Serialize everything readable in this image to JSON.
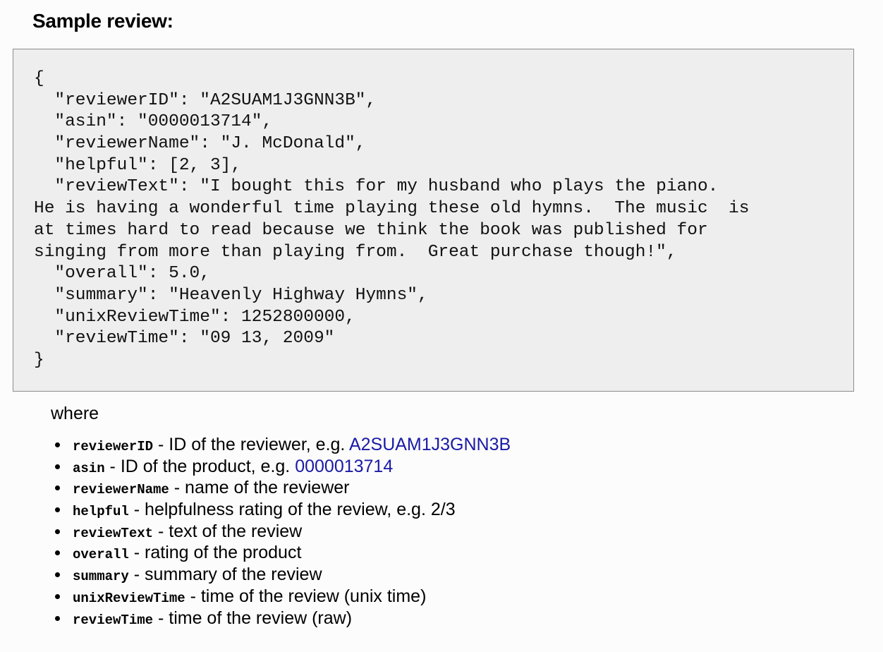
{
  "heading": "Sample review:",
  "code_lines": [
    "{",
    "  \"reviewerID\": \"A2SUAM1J3GNN3B\",",
    "  \"asin\": \"0000013714\",",
    "  \"reviewerName\": \"J. McDonald\",",
    "  \"helpful\": [2, 3],",
    "  \"reviewText\": \"I bought this for my husband who plays the piano.",
    "He is having a wonderful time playing these old hymns.  The music  is",
    "at times hard to read because we think the book was published for",
    "singing from more than playing from.  Great purchase though!\",",
    "  \"overall\": 5.0,",
    "  \"summary\": \"Heavenly Highway Hymns\",",
    "  \"unixReviewTime\": 1252800000,",
    "  \"reviewTime\": \"09 13, 2009\"",
    "}"
  ],
  "where_label": "where",
  "fields": [
    {
      "name": "reviewerID",
      "desc": " - ID of the reviewer, e.g. ",
      "link": "A2SUAM1J3GNN3B"
    },
    {
      "name": "asin",
      "desc": " - ID of the product, e.g. ",
      "link": "0000013714"
    },
    {
      "name": "reviewerName",
      "desc": " - name of the reviewer"
    },
    {
      "name": "helpful",
      "desc": " - helpfulness rating of the review, e.g. 2/3"
    },
    {
      "name": "reviewText",
      "desc": " - text of the review"
    },
    {
      "name": "overall",
      "desc": " - rating of the product"
    },
    {
      "name": "summary",
      "desc": " - summary of the review"
    },
    {
      "name": "unixReviewTime",
      "desc": " - time of the review (unix time)"
    },
    {
      "name": "reviewTime",
      "desc": " - time of the review (raw)"
    }
  ],
  "colors": {
    "link": "#1a1aa6",
    "code_background": "#eeeeee",
    "code_border": "#8c8c8c"
  }
}
